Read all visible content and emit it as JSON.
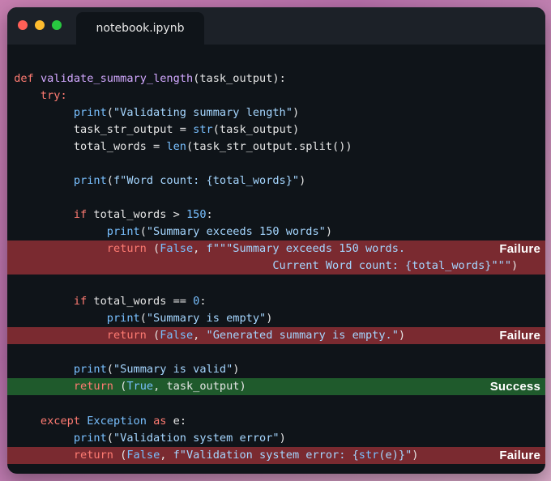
{
  "window": {
    "tab_title": "notebook.ipynb"
  },
  "labels": {
    "failure": "Failure",
    "success": "Success"
  },
  "code": {
    "l1_def": "def",
    "l1_name": "validate_summary_length",
    "l1_params": "(task_output):",
    "l2_try": "try:",
    "l3_print": "print",
    "l3_str": "\"Validating summary length\"",
    "l4_a": "task_str_output = ",
    "l4_str": "str",
    "l4_b": "(task_output)",
    "l5_a": "total_words = ",
    "l5_len": "len",
    "l5_b": "(task_str_output.split())",
    "l6_print": "print",
    "l6_fstr": "f\"Word count: {total_words}\"",
    "l7_if": "if",
    "l7_cond": " total_words > ",
    "l7_num": "150",
    "l7_colon": ":",
    "l8_print": "print",
    "l8_str": "\"Summary exceeds 150 words\"",
    "l9_return": "return",
    "l9_false": "False",
    "l9_str": "f\"\"\"Summary exceeds 150 words.",
    "l10_str": "Current Word count: {total_words}\"\"\"",
    "l11_if": "if",
    "l11_cond": " total_words == ",
    "l11_num": "0",
    "l11_colon": ":",
    "l12_print": "print",
    "l12_str": "\"Summary is empty\"",
    "l13_return": "return",
    "l13_false": "False",
    "l13_str": "\"Generated summary is empty.\"",
    "l14_print": "print",
    "l14_str": "\"Summary is valid\"",
    "l15_return": "return",
    "l15_true": "True",
    "l15_rest": ", task_output)",
    "l16_except": "except",
    "l16_exc": "Exception",
    "l16_as": "as",
    "l16_e": " e:",
    "l17_print": "print",
    "l17_str": "\"Validation system error\"",
    "l18_return": "return",
    "l18_false": "False",
    "l18_fstr": "f\"Validation system error: {",
    "l18_strfn": "str",
    "l18_fstr2": "(e)}\""
  }
}
